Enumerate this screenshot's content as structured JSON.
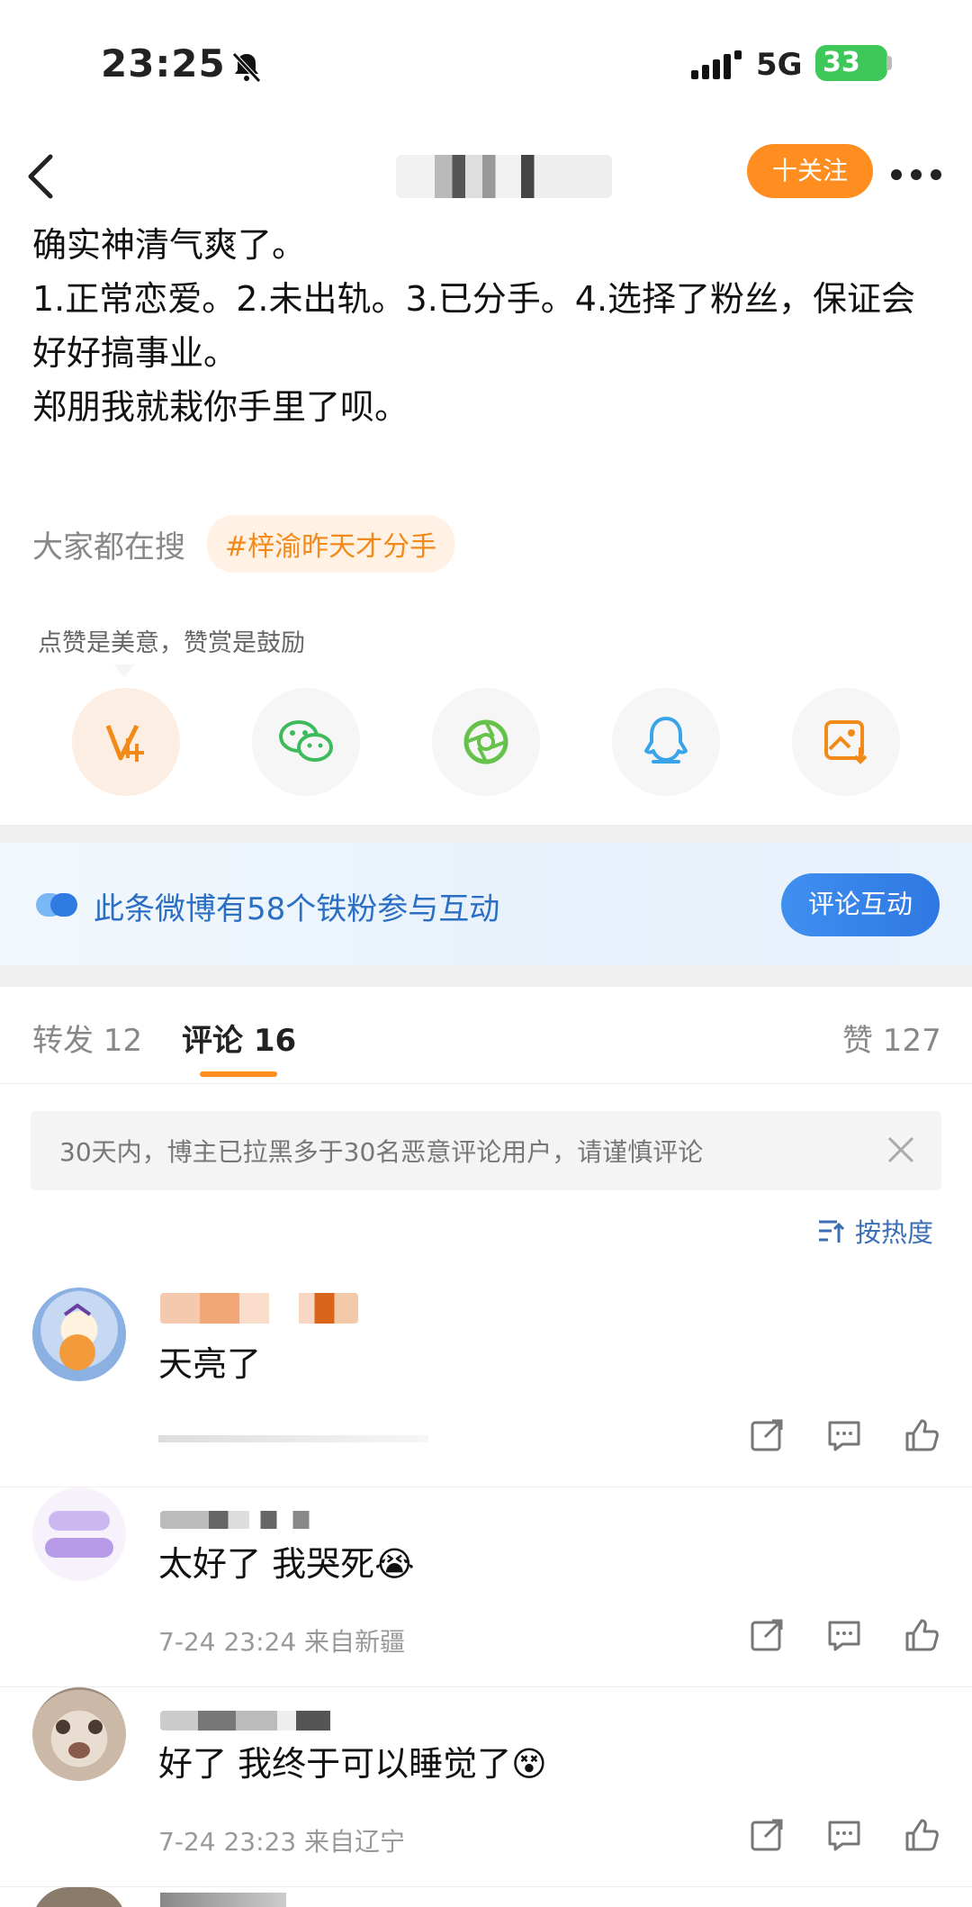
{
  "status_bar": {
    "time": "23:25",
    "network": "5G",
    "battery": "33"
  },
  "header": {
    "follow_label": "十关注"
  },
  "post": {
    "lines": [
      "确实神清气爽了。",
      "1.正常恋爱。2.未出轨。3.已分手。4.选择了粉丝，保证会好好搞事业。",
      "",
      "郑朋我就栽你手里了呗。"
    ]
  },
  "search": {
    "label": "大家都在搜",
    "hashtag": "#梓渝昨天才分手"
  },
  "reward_tip": "点赞是美意，赞赏是鼓励",
  "share_icons": [
    "vip-reward-icon",
    "wechat-icon",
    "moments-icon",
    "qq-icon",
    "save-image-icon"
  ],
  "fans_banner": {
    "text": "此条微博有58个铁粉参与互动",
    "button": "评论互动"
  },
  "tabs": [
    {
      "label": "转发 12"
    },
    {
      "label": "评论 16"
    },
    {
      "label": "赞 127"
    }
  ],
  "notice": {
    "text": "30天内，博主已拉黑多于30名恶意评论用户，请谨慎评论"
  },
  "sort": {
    "label": "按热度"
  },
  "comments": [
    {
      "text": "天亮了",
      "meta": ""
    },
    {
      "text": "太好了 我哭死😭",
      "meta": "7-24 23:24 来自新疆"
    },
    {
      "text": "好了 我终于可以睡觉了😵",
      "meta": "7-24 23:23 来自辽宁"
    }
  ],
  "colors": {
    "accent": "#ff8d20",
    "link_blue": "#2a6fc4",
    "hashtag_bg": "#fff1e3"
  }
}
